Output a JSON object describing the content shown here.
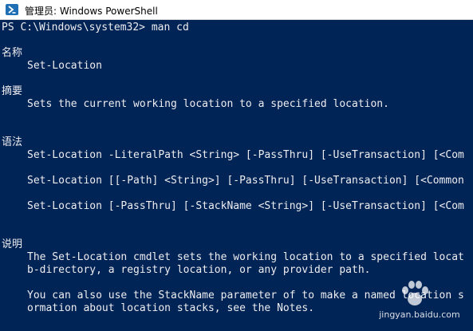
{
  "window": {
    "title": "管理员: Windows PowerShell",
    "icon": "powershell-icon"
  },
  "console": {
    "prompt": "PS C:\\Windows\\system32> man cd",
    "name_heading": "名称",
    "name_value": "Set-Location",
    "synopsis_heading": "摘要",
    "synopsis_value": "Sets the current working location to a specified location.",
    "syntax_heading": "语法",
    "syntax_lines": [
      "Set-Location -LiteralPath <String> [-PassThru] [-UseTransaction] [<Com",
      "Set-Location [[-Path] <String>] [-PassThru] [-UseTransaction] [<Common",
      "Set-Location [-PassThru] [-StackName <String>] [-UseTransaction] [<Com"
    ],
    "description_heading": "说明",
    "description_lines": [
      "The Set-Location cmdlet sets the working location to a specified locat",
      "b-directory, a registry location, or any provider path.",
      "You can also use the StackName parameter of to make a named location s",
      "ormation about location stacks, see the Notes."
    ]
  },
  "watermark": {
    "text": "jingyan.baidu.com"
  },
  "colors": {
    "console_bg": "#012456",
    "console_fg": "#eeedf0",
    "titlebar_bg": "#ffffff"
  }
}
